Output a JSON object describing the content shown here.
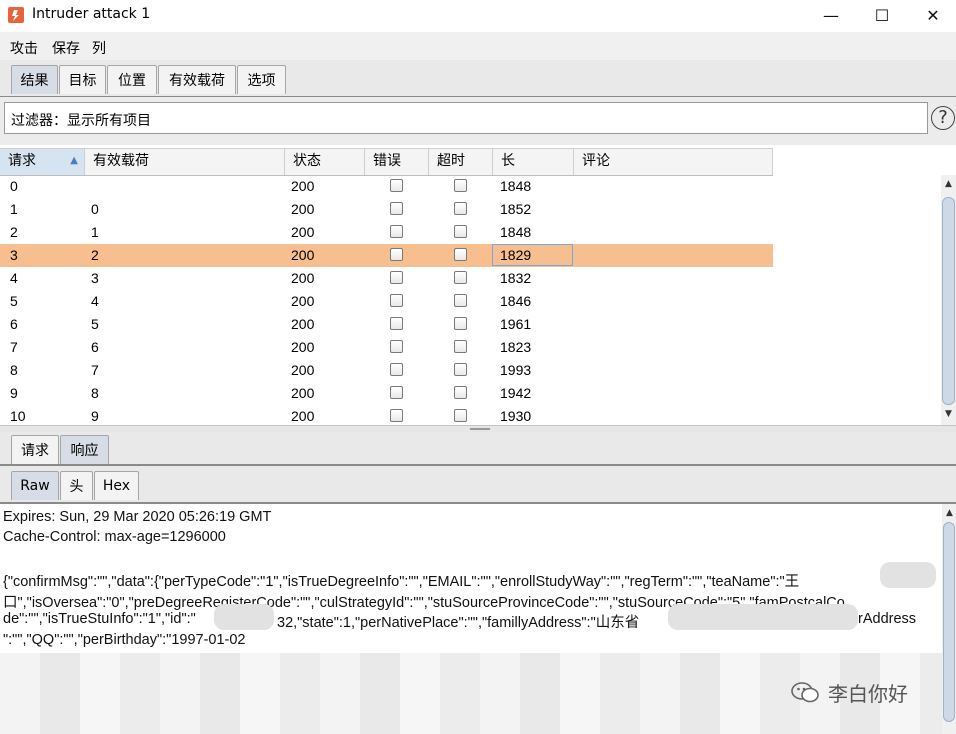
{
  "window": {
    "title": "Intruder attack 1",
    "minimize": "—",
    "maximize": "☐",
    "close": "✕"
  },
  "menu": [
    "攻击",
    "保存",
    "列"
  ],
  "main_tabs": [
    "结果",
    "目标",
    "位置",
    "有效载荷",
    "选项"
  ],
  "filter": {
    "label": "过滤器：",
    "value": "显示所有项目",
    "help": "?"
  },
  "table": {
    "columns": [
      "请求",
      "有效载荷",
      "状态",
      "错误",
      "超时",
      "长",
      "评论"
    ],
    "sort_indicator": "▲",
    "rows": [
      {
        "req": "0",
        "payload": "",
        "status": "200",
        "len": "1848"
      },
      {
        "req": "1",
        "payload": "0",
        "status": "200",
        "len": "1852"
      },
      {
        "req": "2",
        "payload": "1",
        "status": "200",
        "len": "1848"
      },
      {
        "req": "3",
        "payload": "2",
        "status": "200",
        "len": "1829"
      },
      {
        "req": "4",
        "payload": "3",
        "status": "200",
        "len": "1832"
      },
      {
        "req": "5",
        "payload": "4",
        "status": "200",
        "len": "1846"
      },
      {
        "req": "6",
        "payload": "5",
        "status": "200",
        "len": "1961"
      },
      {
        "req": "7",
        "payload": "6",
        "status": "200",
        "len": "1823"
      },
      {
        "req": "8",
        "payload": "7",
        "status": "200",
        "len": "1993"
      },
      {
        "req": "9",
        "payload": "8",
        "status": "200",
        "len": "1942"
      },
      {
        "req": "10",
        "payload": "9",
        "status": "200",
        "len": "1930"
      }
    ],
    "selected_row": 3
  },
  "detail_tabs": [
    "请求",
    "响应"
  ],
  "view_tabs": [
    "Raw",
    "头",
    "Hex"
  ],
  "response_lines": [
    "Expires: Sun, 29 Mar 2020 05:26:19 GMT",
    "Cache-Control: max-age=1296000",
    "",
    "{\"confirmMsg\":\"\",\"data\":{\"perTypeCode\":\"1\",\"isTrueDegreeInfo\":\"\",\"EMAIL\":\"\",\"enrollStudyWay\":\"\",\"regTerm\":\"\",\"teaName\":\"王",
    "口\",\"isOversea\":\"0\",\"preDegreeRegisterCode\":\"\",\"culStrategyId\":\"\",\"stuSourceProvinceCode\":\"\",\"stuSourceCode\":\"5\",\"famPostcalCo",
    "de\":\"\",\"isTrueStuInfo\":\"1\",\"id\":\"",
    "32,\"state\":1,\"perNativePlace\":\"\",\"famillyAddress\":\"山东省",
    "rAddress",
    "\":\"\",\"QQ\":\"\",\"perBirthday\":\"1997-01-02"
  ],
  "watermark": "李白你好",
  "colors": {
    "selected_row": "#f7bf8f",
    "tab_active": "#d6dde6",
    "accent": "#4a7dbf"
  }
}
